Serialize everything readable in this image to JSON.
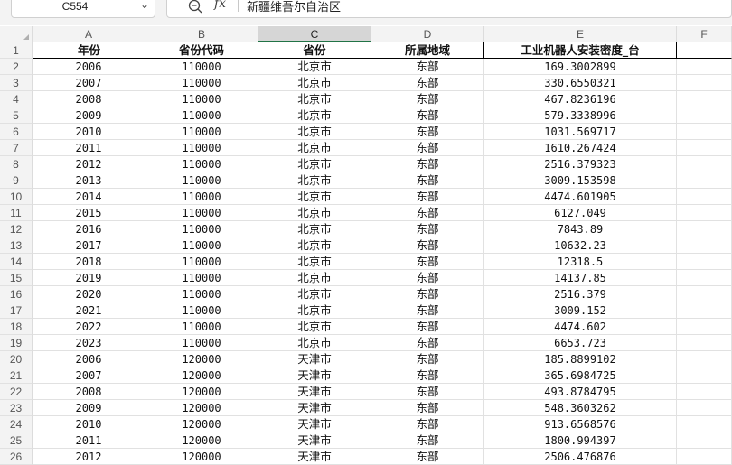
{
  "formula_bar": {
    "name_box": "C554",
    "fx_label": "fx",
    "formula": "新疆维吾尔自治区"
  },
  "columns": [
    "A",
    "B",
    "C",
    "D",
    "E",
    "F"
  ],
  "header_row": {
    "row": "1",
    "cells": [
      "年份",
      "省份代码",
      "省份",
      "所属地域",
      "工业机器人安装密度_台"
    ]
  },
  "rows": [
    {
      "row": "2",
      "cells": [
        "2006",
        "110000",
        "北京市",
        "东部",
        "169.3002899"
      ]
    },
    {
      "row": "3",
      "cells": [
        "2007",
        "110000",
        "北京市",
        "东部",
        "330.6550321"
      ]
    },
    {
      "row": "4",
      "cells": [
        "2008",
        "110000",
        "北京市",
        "东部",
        "467.8236196"
      ]
    },
    {
      "row": "5",
      "cells": [
        "2009",
        "110000",
        "北京市",
        "东部",
        "579.3338996"
      ]
    },
    {
      "row": "6",
      "cells": [
        "2010",
        "110000",
        "北京市",
        "东部",
        "1031.569717"
      ]
    },
    {
      "row": "7",
      "cells": [
        "2011",
        "110000",
        "北京市",
        "东部",
        "1610.267424"
      ]
    },
    {
      "row": "8",
      "cells": [
        "2012",
        "110000",
        "北京市",
        "东部",
        "2516.379323"
      ]
    },
    {
      "row": "9",
      "cells": [
        "2013",
        "110000",
        "北京市",
        "东部",
        "3009.153598"
      ]
    },
    {
      "row": "10",
      "cells": [
        "2014",
        "110000",
        "北京市",
        "东部",
        "4474.601905"
      ]
    },
    {
      "row": "11",
      "cells": [
        "2015",
        "110000",
        "北京市",
        "东部",
        "6127.049"
      ]
    },
    {
      "row": "12",
      "cells": [
        "2016",
        "110000",
        "北京市",
        "东部",
        "7843.89"
      ]
    },
    {
      "row": "13",
      "cells": [
        "2017",
        "110000",
        "北京市",
        "东部",
        "10632.23"
      ]
    },
    {
      "row": "14",
      "cells": [
        "2018",
        "110000",
        "北京市",
        "东部",
        "12318.5"
      ]
    },
    {
      "row": "15",
      "cells": [
        "2019",
        "110000",
        "北京市",
        "东部",
        "14137.85"
      ]
    },
    {
      "row": "16",
      "cells": [
        "2020",
        "110000",
        "北京市",
        "东部",
        "2516.379"
      ]
    },
    {
      "row": "17",
      "cells": [
        "2021",
        "110000",
        "北京市",
        "东部",
        "3009.152"
      ]
    },
    {
      "row": "18",
      "cells": [
        "2022",
        "110000",
        "北京市",
        "东部",
        "4474.602"
      ]
    },
    {
      "row": "19",
      "cells": [
        "2023",
        "110000",
        "北京市",
        "东部",
        "6653.723"
      ]
    },
    {
      "row": "20",
      "cells": [
        "2006",
        "120000",
        "天津市",
        "东部",
        "185.8899102"
      ]
    },
    {
      "row": "21",
      "cells": [
        "2007",
        "120000",
        "天津市",
        "东部",
        "365.6984725"
      ]
    },
    {
      "row": "22",
      "cells": [
        "2008",
        "120000",
        "天津市",
        "东部",
        "493.8784795"
      ]
    },
    {
      "row": "23",
      "cells": [
        "2009",
        "120000",
        "天津市",
        "东部",
        "548.3603262"
      ]
    },
    {
      "row": "24",
      "cells": [
        "2010",
        "120000",
        "天津市",
        "东部",
        "913.6568576"
      ]
    },
    {
      "row": "25",
      "cells": [
        "2011",
        "120000",
        "天津市",
        "东部",
        "1800.994397"
      ]
    },
    {
      "row": "26",
      "cells": [
        "2012",
        "120000",
        "天津市",
        "东部",
        "2506.476876"
      ]
    }
  ]
}
